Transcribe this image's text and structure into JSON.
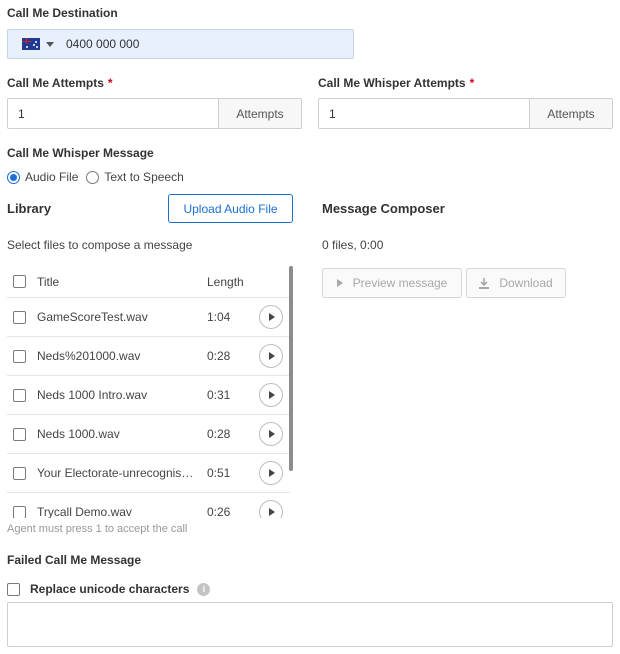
{
  "destination": {
    "label": "Call Me Destination",
    "country_flag": "australia-flag-icon",
    "phone_value": "0400 000 000"
  },
  "attempts": {
    "label": "Call Me Attempts",
    "required_mark": "*",
    "value": "1",
    "addon": "Attempts"
  },
  "whisper_attempts": {
    "label": "Call Me Whisper Attempts",
    "required_mark": "*",
    "value": "1",
    "addon": "Attempts"
  },
  "whisper_message": {
    "label": "Call Me Whisper Message",
    "options": [
      {
        "label": "Audio File",
        "selected": true
      },
      {
        "label": "Text to Speech",
        "selected": false
      }
    ]
  },
  "library": {
    "title": "Library",
    "upload_button": "Upload Audio File",
    "hint": "Select files to compose a message",
    "columns": {
      "title": "Title",
      "length": "Length"
    },
    "files": [
      {
        "title": "GameScoreTest.wav",
        "length": "1:04"
      },
      {
        "title": "Neds%201000.wav",
        "length": "0:28"
      },
      {
        "title": "Neds 1000 Intro.wav",
        "length": "0:31"
      },
      {
        "title": "Neds 1000.wav",
        "length": "0:28"
      },
      {
        "title": "Your Electorate-unrecognised.wav",
        "length": "0:51"
      },
      {
        "title": "Trycall Demo.wav",
        "length": "0:26"
      }
    ]
  },
  "composer": {
    "title": "Message Composer",
    "summary": "0 files, 0:00",
    "preview_button": "Preview message",
    "download_button": "Download"
  },
  "agent_note": "Agent must press 1 to accept the call",
  "failed_message": {
    "label": "Failed Call Me Message",
    "replace_unicode_label": "Replace unicode characters",
    "value": ""
  },
  "colors": {
    "accent": "#1a6fd1",
    "required": "#d0021b",
    "autofill_bg": "#e8f0fe"
  }
}
